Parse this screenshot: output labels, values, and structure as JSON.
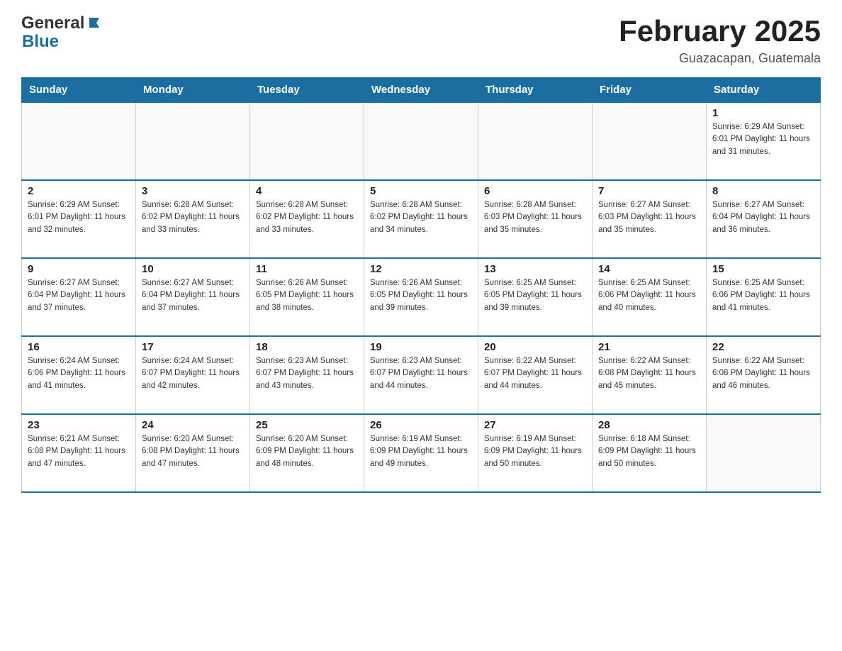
{
  "header": {
    "logo_general": "General",
    "logo_blue": "Blue",
    "month_year": "February 2025",
    "location": "Guazacapan, Guatemala"
  },
  "days_of_week": [
    "Sunday",
    "Monday",
    "Tuesday",
    "Wednesday",
    "Thursday",
    "Friday",
    "Saturday"
  ],
  "weeks": [
    {
      "days": [
        {
          "date": "",
          "info": ""
        },
        {
          "date": "",
          "info": ""
        },
        {
          "date": "",
          "info": ""
        },
        {
          "date": "",
          "info": ""
        },
        {
          "date": "",
          "info": ""
        },
        {
          "date": "",
          "info": ""
        },
        {
          "date": "1",
          "info": "Sunrise: 6:29 AM\nSunset: 6:01 PM\nDaylight: 11 hours\nand 31 minutes."
        }
      ]
    },
    {
      "days": [
        {
          "date": "2",
          "info": "Sunrise: 6:29 AM\nSunset: 6:01 PM\nDaylight: 11 hours\nand 32 minutes."
        },
        {
          "date": "3",
          "info": "Sunrise: 6:28 AM\nSunset: 6:02 PM\nDaylight: 11 hours\nand 33 minutes."
        },
        {
          "date": "4",
          "info": "Sunrise: 6:28 AM\nSunset: 6:02 PM\nDaylight: 11 hours\nand 33 minutes."
        },
        {
          "date": "5",
          "info": "Sunrise: 6:28 AM\nSunset: 6:02 PM\nDaylight: 11 hours\nand 34 minutes."
        },
        {
          "date": "6",
          "info": "Sunrise: 6:28 AM\nSunset: 6:03 PM\nDaylight: 11 hours\nand 35 minutes."
        },
        {
          "date": "7",
          "info": "Sunrise: 6:27 AM\nSunset: 6:03 PM\nDaylight: 11 hours\nand 35 minutes."
        },
        {
          "date": "8",
          "info": "Sunrise: 6:27 AM\nSunset: 6:04 PM\nDaylight: 11 hours\nand 36 minutes."
        }
      ]
    },
    {
      "days": [
        {
          "date": "9",
          "info": "Sunrise: 6:27 AM\nSunset: 6:04 PM\nDaylight: 11 hours\nand 37 minutes."
        },
        {
          "date": "10",
          "info": "Sunrise: 6:27 AM\nSunset: 6:04 PM\nDaylight: 11 hours\nand 37 minutes."
        },
        {
          "date": "11",
          "info": "Sunrise: 6:26 AM\nSunset: 6:05 PM\nDaylight: 11 hours\nand 38 minutes."
        },
        {
          "date": "12",
          "info": "Sunrise: 6:26 AM\nSunset: 6:05 PM\nDaylight: 11 hours\nand 39 minutes."
        },
        {
          "date": "13",
          "info": "Sunrise: 6:25 AM\nSunset: 6:05 PM\nDaylight: 11 hours\nand 39 minutes."
        },
        {
          "date": "14",
          "info": "Sunrise: 6:25 AM\nSunset: 6:06 PM\nDaylight: 11 hours\nand 40 minutes."
        },
        {
          "date": "15",
          "info": "Sunrise: 6:25 AM\nSunset: 6:06 PM\nDaylight: 11 hours\nand 41 minutes."
        }
      ]
    },
    {
      "days": [
        {
          "date": "16",
          "info": "Sunrise: 6:24 AM\nSunset: 6:06 PM\nDaylight: 11 hours\nand 41 minutes."
        },
        {
          "date": "17",
          "info": "Sunrise: 6:24 AM\nSunset: 6:07 PM\nDaylight: 11 hours\nand 42 minutes."
        },
        {
          "date": "18",
          "info": "Sunrise: 6:23 AM\nSunset: 6:07 PM\nDaylight: 11 hours\nand 43 minutes."
        },
        {
          "date": "19",
          "info": "Sunrise: 6:23 AM\nSunset: 6:07 PM\nDaylight: 11 hours\nand 44 minutes."
        },
        {
          "date": "20",
          "info": "Sunrise: 6:22 AM\nSunset: 6:07 PM\nDaylight: 11 hours\nand 44 minutes."
        },
        {
          "date": "21",
          "info": "Sunrise: 6:22 AM\nSunset: 6:08 PM\nDaylight: 11 hours\nand 45 minutes."
        },
        {
          "date": "22",
          "info": "Sunrise: 6:22 AM\nSunset: 6:08 PM\nDaylight: 11 hours\nand 46 minutes."
        }
      ]
    },
    {
      "days": [
        {
          "date": "23",
          "info": "Sunrise: 6:21 AM\nSunset: 6:08 PM\nDaylight: 11 hours\nand 47 minutes."
        },
        {
          "date": "24",
          "info": "Sunrise: 6:20 AM\nSunset: 6:08 PM\nDaylight: 11 hours\nand 47 minutes."
        },
        {
          "date": "25",
          "info": "Sunrise: 6:20 AM\nSunset: 6:09 PM\nDaylight: 11 hours\nand 48 minutes."
        },
        {
          "date": "26",
          "info": "Sunrise: 6:19 AM\nSunset: 6:09 PM\nDaylight: 11 hours\nand 49 minutes."
        },
        {
          "date": "27",
          "info": "Sunrise: 6:19 AM\nSunset: 6:09 PM\nDaylight: 11 hours\nand 50 minutes."
        },
        {
          "date": "28",
          "info": "Sunrise: 6:18 AM\nSunset: 6:09 PM\nDaylight: 11 hours\nand 50 minutes."
        },
        {
          "date": "",
          "info": ""
        }
      ]
    }
  ]
}
